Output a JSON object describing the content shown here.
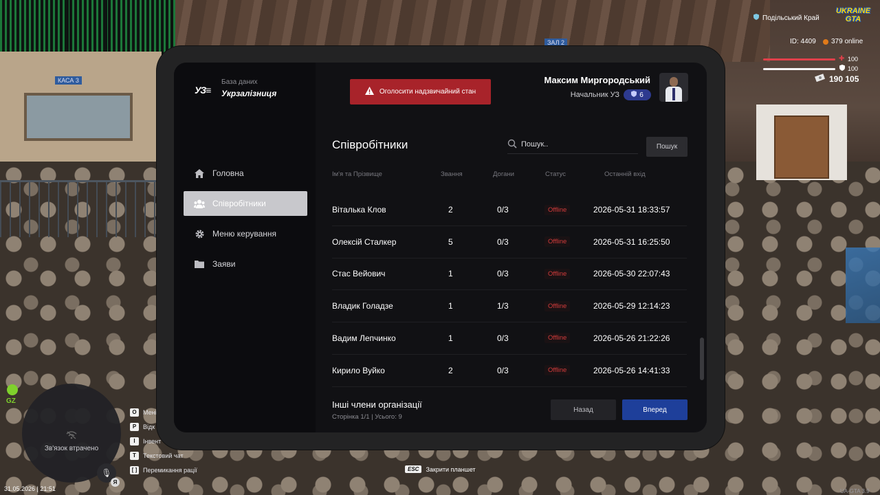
{
  "scene": {
    "kasa_sign": "КАСА 3",
    "zal_sign": "ЗАЛ 2"
  },
  "app": {
    "logo_mark": "УЗ",
    "logo_subtitle": "База даних",
    "logo_title": "Укрзалізниця"
  },
  "header": {
    "alert_button": "Оголосити надзвичайний стан",
    "user_name": "Максим Миргородський",
    "user_role": "Начальник УЗ",
    "rank_badge": "6"
  },
  "sidebar": {
    "items": [
      {
        "label": "Головна",
        "icon": "home-icon",
        "active": false
      },
      {
        "label": "Співробітники",
        "icon": "users-icon",
        "active": true
      },
      {
        "label": "Меню керування",
        "icon": "gear-icon",
        "active": false
      },
      {
        "label": "Заяви",
        "icon": "folder-icon",
        "active": false
      }
    ]
  },
  "main": {
    "title": "Співробітники",
    "search_placeholder": "Пошук..",
    "search_button": "Пошук",
    "columns": [
      "Ім'я та Прізвище",
      "Звання",
      "Догани",
      "Статус",
      "Останній вхід"
    ],
    "rows": [
      {
        "name": "Віталька Клов",
        "rank": "2",
        "warnings": "0/3",
        "status": "Offline",
        "last_login": "2026-05-31 18:33:57"
      },
      {
        "name": "Олексій Сталкер",
        "rank": "5",
        "warnings": "0/3",
        "status": "Offline",
        "last_login": "2026-05-31 16:25:50"
      },
      {
        "name": "Стас Вейович",
        "rank": "1",
        "warnings": "0/3",
        "status": "Offline",
        "last_login": "2026-05-30 22:07:43"
      },
      {
        "name": "Владик Голадзе",
        "rank": "1",
        "warnings": "1/3",
        "status": "Offline",
        "last_login": "2026-05-29 12:14:23"
      },
      {
        "name": "Вадим Лепчинко",
        "rank": "1",
        "warnings": "0/3",
        "status": "Offline",
        "last_login": "2026-05-26 21:22:26"
      },
      {
        "name": "Кирило Вуйко",
        "rank": "2",
        "warnings": "0/3",
        "status": "Offline",
        "last_login": "2026-05-26 14:41:33"
      }
    ],
    "footer_title": "Інші члени організації",
    "footer_pagination": "Сторінка 1/1 | Усього: 9",
    "back_button": "Назад",
    "next_button": "Вперед"
  },
  "hud": {
    "region": "Подільський Край",
    "logo": "UKRAINE GTA",
    "player_id": "ID: 4409",
    "online": "379 online",
    "health": "100",
    "armor": "100",
    "money": "190 105",
    "map_status": "Зв'язок втрачено",
    "gz_label": "GZ",
    "mic_key": "Я",
    "keys": [
      {
        "key": "O",
        "label": "Мені"
      },
      {
        "key": "P",
        "label": "Відк"
      },
      {
        "key": "I",
        "label": "Інвент"
      },
      {
        "key": "T",
        "label": "Текстовий чат"
      },
      {
        "key": "[ ]",
        "label": "Перемикання рації"
      }
    ],
    "datetime": "31.05.2026 | 21:51",
    "esc_key": "ESC",
    "esc_label": "Закрити планшет",
    "version": "UA-GTA 3.9"
  },
  "colors": {
    "accent_blue": "#1e3f9a",
    "alert_red": "#a8232a",
    "status_offline": "#d23b3b",
    "badge_blue": "#2d3a8f"
  }
}
